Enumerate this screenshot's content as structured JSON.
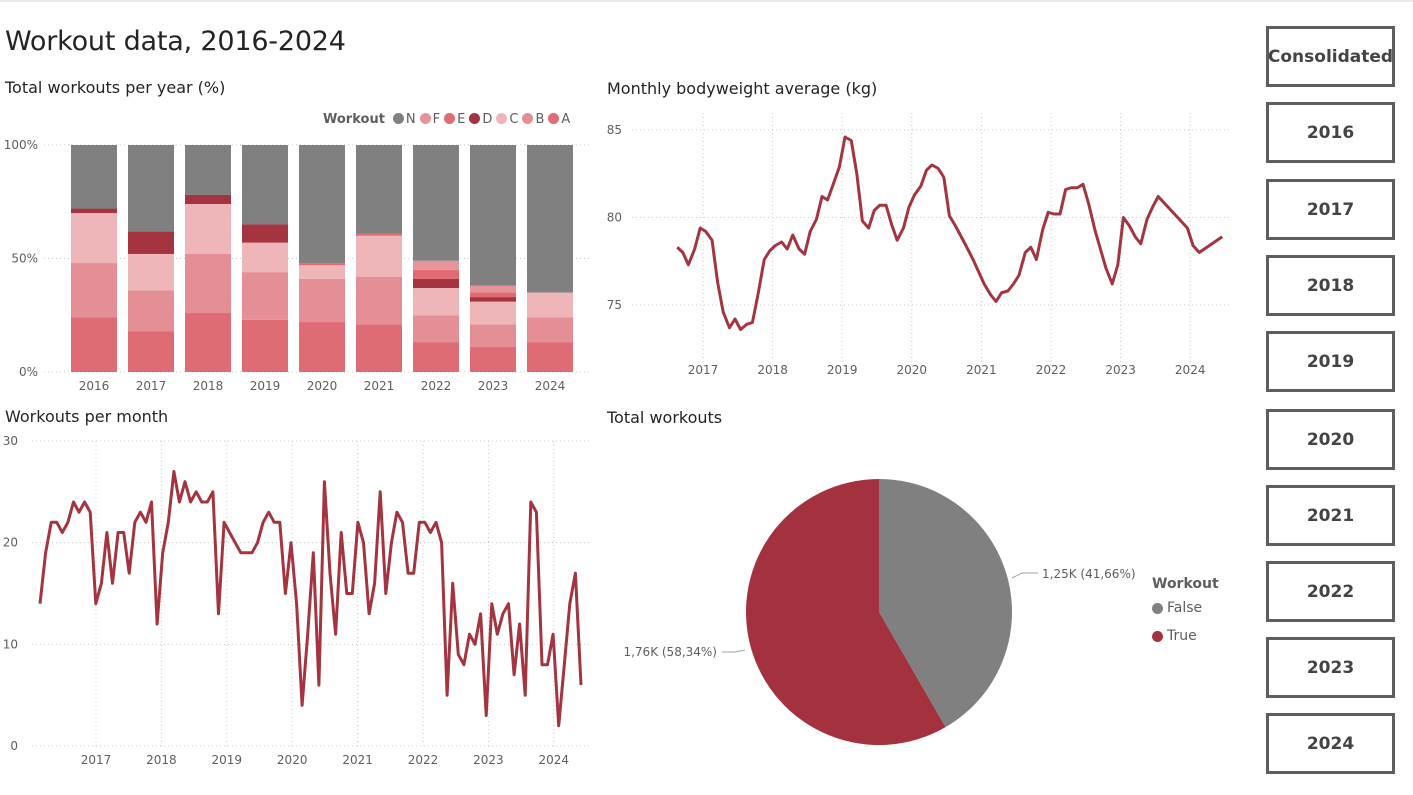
{
  "page": {
    "title": "Workout data, 2016-2024"
  },
  "slicers": [
    "Consolidated",
    "2016",
    "2017",
    "2018",
    "2019",
    "2020",
    "2021",
    "2022",
    "2023",
    "2024"
  ],
  "colors": {
    "N": "#808080",
    "F": "#e6949a",
    "E": "#e06b73",
    "D": "#a4343f",
    "C": "#efb6ba",
    "B": "#e48f95",
    "A": "#df6b75",
    "line": "#a4343f",
    "pie_false": "#808080",
    "pie_true": "#a4323e"
  },
  "chart_data": [
    {
      "id": "stacked",
      "type": "bar",
      "stacked": "100%",
      "title": "Total workouts per year (%)",
      "legend_title": "Workout",
      "legend_position": "top-right",
      "categories": [
        "2016",
        "2017",
        "2018",
        "2019",
        "2020",
        "2021",
        "2022",
        "2023",
        "2024"
      ],
      "ytick_labels": [
        "100%",
        "50%",
        "0%"
      ],
      "series": [
        {
          "name": "A",
          "values": [
            24,
            18,
            26,
            23,
            22,
            21,
            13,
            11,
            13
          ]
        },
        {
          "name": "B",
          "values": [
            24,
            18,
            26,
            21,
            19,
            21,
            12,
            10,
            11
          ]
        },
        {
          "name": "C",
          "values": [
            22,
            16,
            22,
            13,
            6,
            18,
            12,
            10,
            11
          ]
        },
        {
          "name": "D",
          "values": [
            2,
            10,
            4,
            8,
            0,
            0,
            4,
            2,
            0
          ]
        },
        {
          "name": "E",
          "values": [
            0,
            0,
            0,
            0,
            1,
            1,
            4,
            2,
            0
          ]
        },
        {
          "name": "F",
          "values": [
            0,
            0,
            0,
            0,
            0,
            0,
            4,
            3,
            0
          ]
        },
        {
          "name": "N",
          "values": [
            28,
            38,
            22,
            35,
            52,
            39,
            51,
            62,
            65
          ]
        }
      ],
      "legend_order": [
        "N",
        "F",
        "E",
        "D",
        "C",
        "B",
        "A"
      ],
      "grid": true
    },
    {
      "id": "bodyweight",
      "type": "line",
      "title": "Monthly bodyweight average (kg)",
      "y_ticks": [
        75,
        80,
        85
      ],
      "ylim": [
        72,
        86
      ],
      "xlim": [
        2016.6,
        2024.6
      ],
      "x_ticks": [
        "2017",
        "2018",
        "2019",
        "2020",
        "2021",
        "2022",
        "2023",
        "2024"
      ],
      "x": [
        2016.63,
        2016.71,
        2016.79,
        2016.88,
        2016.96,
        2017.04,
        2017.13,
        2017.21,
        2017.29,
        2017.38,
        2017.46,
        2017.54,
        2017.63,
        2017.71,
        2017.79,
        2017.88,
        2017.96,
        2018.04,
        2018.13,
        2018.21,
        2018.29,
        2018.38,
        2018.46,
        2018.54,
        2018.63,
        2018.71,
        2018.79,
        2018.88,
        2018.96,
        2019.04,
        2019.13,
        2019.21,
        2019.29,
        2019.38,
        2019.46,
        2019.54,
        2019.63,
        2019.71,
        2019.79,
        2019.88,
        2019.96,
        2020.04,
        2020.13,
        2020.21,
        2020.29,
        2020.38,
        2020.46,
        2020.54,
        2020.63,
        2020.71,
        2020.79,
        2020.88,
        2020.96,
        2021.04,
        2021.13,
        2021.21,
        2021.29,
        2021.38,
        2021.46,
        2021.54,
        2021.63,
        2021.71,
        2021.79,
        2021.88,
        2021.96,
        2022.04,
        2022.13,
        2022.21,
        2022.29,
        2022.38,
        2022.46,
        2022.54,
        2022.63,
        2022.71,
        2022.79,
        2022.88,
        2022.96,
        2023.04,
        2023.13,
        2023.21,
        2023.29,
        2023.38,
        2023.46,
        2023.54,
        2023.96,
        2024.04,
        2024.13,
        2024.46
      ],
      "y": [
        78.3,
        78.0,
        77.3,
        78.2,
        79.4,
        79.2,
        78.7,
        76.3,
        74.6,
        73.7,
        74.2,
        73.6,
        73.9,
        74.0,
        75.6,
        77.6,
        78.1,
        78.4,
        78.6,
        78.2,
        79.0,
        78.2,
        77.9,
        79.2,
        79.9,
        81.2,
        81.0,
        82.0,
        82.9,
        84.6,
        84.4,
        82.5,
        79.8,
        79.4,
        80.4,
        80.7,
        80.7,
        79.6,
        78.7,
        79.4,
        80.6,
        81.3,
        81.8,
        82.7,
        83.0,
        82.8,
        82.3,
        80.1,
        79.5,
        78.9,
        78.3,
        77.6,
        76.9,
        76.2,
        75.6,
        75.2,
        75.7,
        75.8,
        76.2,
        76.7,
        78.0,
        78.3,
        77.6,
        79.3,
        80.3,
        80.2,
        80.2,
        81.6,
        81.7,
        81.7,
        81.9,
        80.8,
        79.3,
        78.2,
        77.1,
        76.2,
        77.3,
        80.0,
        79.5,
        78.9,
        78.5,
        79.9,
        80.6,
        81.2,
        79.4,
        78.4,
        78.0,
        78.9,
        80.0,
        79.9,
        79.7
      ],
      "grid": true
    },
    {
      "id": "permonth",
      "type": "line",
      "title": "Workouts per month",
      "y_ticks": [
        0,
        10,
        20,
        30
      ],
      "ylim": [
        0,
        30
      ],
      "xlim": [
        2016.2,
        2024.55
      ],
      "x_ticks": [
        "2017",
        "2018",
        "2019",
        "2020",
        "2021",
        "2022",
        "2023",
        "2024"
      ],
      "y": [
        14,
        19,
        22,
        22,
        21,
        22,
        24,
        23,
        24,
        23,
        14,
        16,
        21,
        16,
        21,
        21,
        17,
        22,
        23,
        22,
        24,
        12,
        19,
        22,
        27,
        24,
        26,
        24,
        25,
        24,
        24,
        25,
        13,
        22,
        21,
        20,
        19,
        19,
        19,
        20,
        22,
        23,
        22,
        22,
        15,
        20,
        14,
        4,
        11,
        19,
        6,
        26,
        17,
        11,
        21,
        15,
        15,
        22,
        20,
        13,
        16,
        25,
        15,
        20,
        23,
        22,
        17,
        17,
        22,
        22,
        21,
        22,
        20,
        5,
        16,
        9,
        8,
        11,
        10,
        13,
        3,
        14,
        11,
        13,
        14,
        7,
        12,
        5,
        24,
        23,
        8,
        8,
        11,
        2,
        8,
        14,
        17,
        6
      ],
      "grid": true
    },
    {
      "id": "pie",
      "type": "pie",
      "title": "Total workouts",
      "legend_title": "Workout",
      "legend_position": "right",
      "slices": [
        {
          "name": "False",
          "value": 1250,
          "pct": 41.66,
          "label": "1,25K (41,66%)"
        },
        {
          "name": "True",
          "value": 1760,
          "pct": 58.34,
          "label": "1,76K (58,34%)"
        }
      ]
    }
  ]
}
